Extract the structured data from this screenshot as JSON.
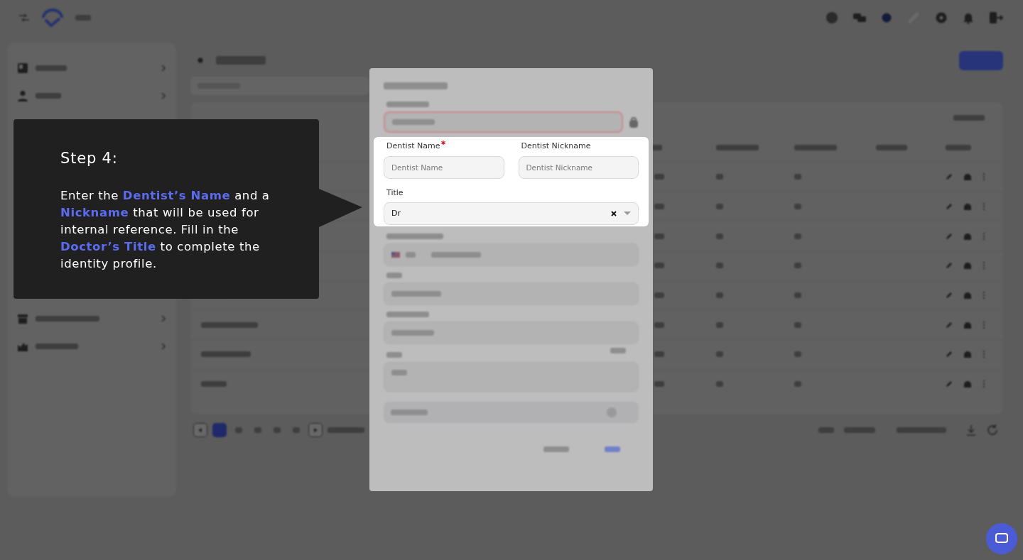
{
  "form": {
    "name_field": {
      "label": "Dentist Name",
      "required": true,
      "placeholder": "Dentist Name"
    },
    "nickname_field": {
      "label": "Dentist Nickname",
      "required": false,
      "placeholder": "Dentist Nickname"
    },
    "title_field": {
      "label": "Title",
      "value": "Dr"
    }
  },
  "tooltip": {
    "heading": "Step 4:",
    "body": "Enter the **Dentist’s Name** and a **Nickname** that will be used for internal reference. Fill in the **Doctor’s Title** to complete the identity profile."
  }
}
